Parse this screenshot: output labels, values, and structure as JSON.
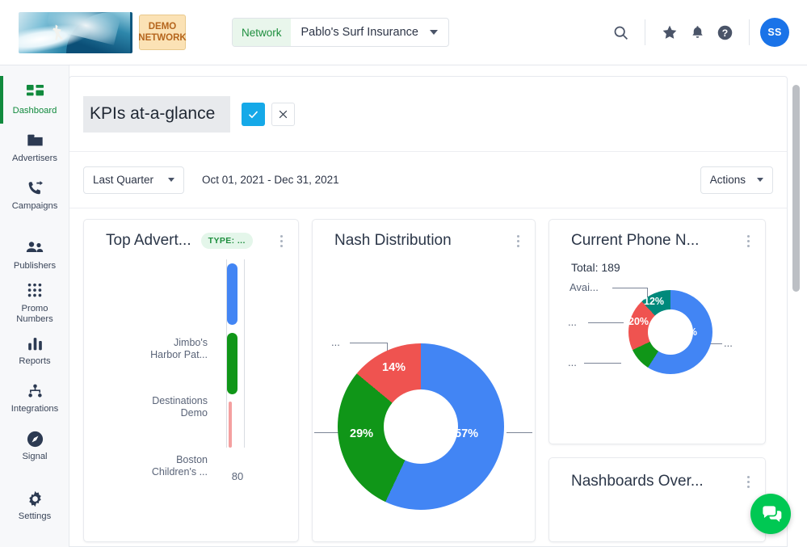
{
  "header": {
    "logo_alt": "Surfer riding a wave logo",
    "demo_badge_line1": "DEMO",
    "demo_badge_line2": "NETWORK",
    "network_label": "Network",
    "network_value": "Pablo's Surf Insurance",
    "icons": {
      "search": "search-icon",
      "star": "star-icon",
      "bell": "bell-icon",
      "help": "help-icon"
    },
    "avatar_initials": "SS"
  },
  "sidebar": {
    "items": [
      {
        "label": "Dashboard",
        "icon": "dashboard-icon",
        "active": true
      },
      {
        "label": "Advertisers",
        "icon": "folder-icon",
        "active": false
      },
      {
        "label": "Campaigns",
        "icon": "phone-forward-icon",
        "active": false
      },
      {
        "label": "Publishers",
        "icon": "people-icon",
        "active": false
      },
      {
        "label": "Promo\nNumbers",
        "icon": "keypad-icon",
        "active": false
      },
      {
        "label": "Reports",
        "icon": "bar-chart-icon",
        "active": false
      },
      {
        "label": "Integrations",
        "icon": "nodes-icon",
        "active": false
      },
      {
        "label": "Signal",
        "icon": "compass-icon",
        "active": false
      },
      {
        "label": "Settings",
        "icon": "gear-icon",
        "active": false
      }
    ]
  },
  "dashboard": {
    "title_value": "KPIs at-a-glance",
    "title_placeholder": "Dashboard name",
    "confirm_label": "✓",
    "cancel_label": "×",
    "range_label": "Last Quarter",
    "date_range": "Oct 01, 2021 - Dec 31, 2021",
    "actions_label": "Actions"
  },
  "widgets": [
    {
      "title": "Top Advert...",
      "badge": "TYPE: ...",
      "menu": "kebab-menu-icon"
    },
    {
      "title": "Nash Distribution",
      "menu": "kebab-menu-icon"
    },
    {
      "title": "Current Phone N...",
      "total": "Total: 189",
      "menu": "kebab-menu-icon"
    },
    {
      "title": "Nashboards Over...",
      "menu": "kebab-menu-icon"
    }
  ],
  "colors": {
    "blue": "#4285F4",
    "green": "#109618",
    "red": "#EF5350",
    "teal": "#00897B",
    "pink": "#F4A0A0",
    "accent_green": "#118a3d",
    "avatar_blue": "#1a73e8",
    "confirm_blue": "#15a9e8",
    "chat_green": "#00c853"
  },
  "chart_data": [
    {
      "type": "bar",
      "orientation": "horizontal",
      "title": "Top Advert...",
      "categories": [
        "Jimbo's\nHarbor Pat...",
        "Destinations\nDemo",
        "Boston\nChildren's ..."
      ],
      "values": [
        80,
        80,
        80
      ],
      "bar_colors": [
        "#4285F4",
        "#109618",
        "#F4A0A0"
      ],
      "xlabel": "",
      "ylabel": "",
      "xticks": [
        "80"
      ],
      "xlim": [
        0,
        80
      ],
      "grid": false,
      "legend": "none"
    },
    {
      "type": "pie",
      "variant": "donut",
      "title": "Nash Distribution",
      "labels": [
        "...",
        "...",
        "..."
      ],
      "values": [
        57,
        29,
        14
      ],
      "value_labels": [
        "57%",
        "29%",
        "14%"
      ],
      "slice_colors": [
        "#4285F4",
        "#109618",
        "#EF5350"
      ],
      "legend": "leader-lines",
      "annotations": [
        "...",
        "...",
        "..."
      ]
    },
    {
      "type": "pie",
      "variant": "donut",
      "title": "Current Phone N...",
      "subtitle": "Total: 189",
      "labels": [
        "...",
        "...",
        "...",
        "Avai..."
      ],
      "values": [
        59,
        9,
        20,
        12
      ],
      "value_labels": [
        "59%",
        "",
        "20%",
        "12%"
      ],
      "slice_colors": [
        "#4285F4",
        "#109618",
        "#EF5350",
        "#00897B"
      ],
      "legend": "leader-lines",
      "annotations": [
        "...",
        "...",
        "...",
        "Avai..."
      ]
    }
  ],
  "chat": {
    "icon": "chat-bubble-icon"
  },
  "scrollbar": {
    "name": "vertical-scrollbar"
  }
}
